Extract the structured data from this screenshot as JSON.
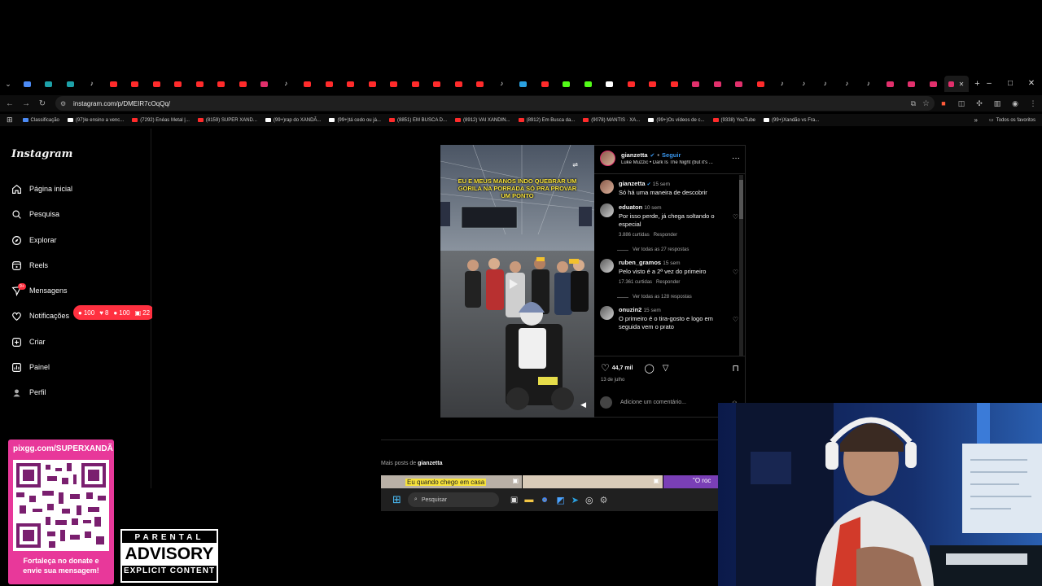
{
  "browser": {
    "tabs": [
      {
        "color": "#4c8bf5",
        "kind": "fav"
      },
      {
        "color": "#1da1a8",
        "kind": "fav"
      },
      {
        "color": "#1da1a8",
        "kind": "fav"
      },
      {
        "color": "#fff",
        "kind": "tiktok"
      },
      {
        "color": "#ff2b2b",
        "kind": "fav"
      },
      {
        "color": "#ff2b2b",
        "kind": "fav"
      },
      {
        "color": "#ff2b2b",
        "kind": "fav"
      },
      {
        "color": "#ff2b2b",
        "kind": "fav"
      },
      {
        "color": "#ff2b2b",
        "kind": "fav"
      },
      {
        "color": "#ff2b2b",
        "kind": "fav"
      },
      {
        "color": "#ff2b2b",
        "kind": "fav"
      },
      {
        "color": "#e1306c",
        "kind": "fav"
      },
      {
        "color": "#fff",
        "kind": "tiktok"
      },
      {
        "color": "#ff2b2b",
        "kind": "fav"
      },
      {
        "color": "#ff2b2b",
        "kind": "fav"
      },
      {
        "color": "#ff2b2b",
        "kind": "fav"
      },
      {
        "color": "#ff2b2b",
        "kind": "fav"
      },
      {
        "color": "#ff2b2b",
        "kind": "fav"
      },
      {
        "color": "#ff2b2b",
        "kind": "fav"
      },
      {
        "color": "#ff2b2b",
        "kind": "fav"
      },
      {
        "color": "#ff2b2b",
        "kind": "fav"
      },
      {
        "color": "#ff2b2b",
        "kind": "fav"
      },
      {
        "color": "#fff",
        "kind": "tiktok"
      },
      {
        "color": "#2aa1e0",
        "kind": "fav"
      },
      {
        "color": "#ff2b2b",
        "kind": "fav"
      },
      {
        "color": "#53fc18",
        "kind": "fav"
      },
      {
        "color": "#53fc18",
        "kind": "fav"
      },
      {
        "color": "#ffffff",
        "kind": "fav"
      },
      {
        "color": "#ff2b2b",
        "kind": "fav"
      },
      {
        "color": "#ff2b2b",
        "kind": "fav"
      },
      {
        "color": "#ff2b2b",
        "kind": "fav"
      },
      {
        "color": "#e1306c",
        "kind": "fav"
      },
      {
        "color": "#e1306c",
        "kind": "fav"
      },
      {
        "color": "#e1306c",
        "kind": "fav"
      },
      {
        "color": "#ff2b2b",
        "kind": "fav"
      },
      {
        "color": "#fff",
        "kind": "tiktok"
      },
      {
        "color": "#fff",
        "kind": "tiktok"
      },
      {
        "color": "#fff",
        "kind": "tiktok"
      },
      {
        "color": "#fff",
        "kind": "tiktok"
      },
      {
        "color": "#fff",
        "kind": "tiktok"
      },
      {
        "color": "#e1306c",
        "kind": "fav"
      },
      {
        "color": "#e1306c",
        "kind": "fav"
      },
      {
        "color": "#e1306c",
        "kind": "fav"
      }
    ],
    "url": "instagram.com/p/DMEIR7cOqQq/",
    "window_controls": [
      "–",
      "□",
      "✕"
    ],
    "bookmarks": [
      {
        "label": "Classificação",
        "color": "#4c8bf5"
      },
      {
        "label": "(97)Ie ensino a venc...",
        "color": "#ffffff"
      },
      {
        "label": "(7292) Enéas Metal |...",
        "color": "#ff2b2b"
      },
      {
        "label": "(8159) SUPER XAND...",
        "color": "#ff2b2b"
      },
      {
        "label": "(99+)rap do XANDÃ...",
        "color": "#ffffff"
      },
      {
        "label": "(99+)tá cedo ou já...",
        "color": "#ffffff"
      },
      {
        "label": "(8851) EM BUSCA D...",
        "color": "#ff2b2b"
      },
      {
        "label": "(8912) VAI XANDIN...",
        "color": "#ff2b2b"
      },
      {
        "label": "(8912) Em Busca da...",
        "color": "#ff2b2b"
      },
      {
        "label": "(9078) MANTIS · XA...",
        "color": "#ff2b2b"
      },
      {
        "label": "(99+)Os vídeos de c...",
        "color": "#ffffff"
      },
      {
        "label": "(9338) YouTube",
        "color": "#ff2b2b"
      },
      {
        "label": "(99+)Xandão vs Fra...",
        "color": "#ffffff"
      }
    ],
    "bookmarks_folder": "Todos os favoritos"
  },
  "instagram": {
    "logo": "Instagram",
    "nav": [
      {
        "label": "Página inicial",
        "icon": "home-icon"
      },
      {
        "label": "Pesquisa",
        "icon": "search-icon"
      },
      {
        "label": "Explorar",
        "icon": "compass-icon"
      },
      {
        "label": "Reels",
        "icon": "reels-icon"
      },
      {
        "label": "Mensagens",
        "icon": "messenger-icon"
      },
      {
        "label": "Notificações",
        "icon": "heart-icon"
      },
      {
        "label": "Criar",
        "icon": "plus-square-icon"
      },
      {
        "label": "Painel",
        "icon": "chart-icon"
      },
      {
        "label": "Perfil",
        "icon": "avatar-icon"
      }
    ],
    "messages_badge": "9+",
    "notification_pill": {
      "comments": "100",
      "likes": "8",
      "follows": "100",
      "mentions": "22"
    },
    "post": {
      "video_caption": "EU E MEUS MANOS INDO QUEBRAR UM GORILA NA PORRADA SÓ PRA PROVAR UM PONTO",
      "author": "gianzetta",
      "follow_label": "Seguir",
      "separator": "•",
      "audio": "Luke Muzzic • Dark Is The Night (but it's ...",
      "caption_time": "15 sem",
      "caption_text": "Só há uma maneira de descobrir",
      "comments": [
        {
          "user": "eduaton",
          "time": "10 sem",
          "text": "Por isso perde, já chega soltando o especial",
          "likes": "3.886 curtidas",
          "reply": "Responder",
          "replies": "Ver todas as 27 respostas"
        },
        {
          "user": "ruben_gramos",
          "time": "15 sem",
          "text": "Pelo visto é a 2ª vez do primeiro",
          "likes": "17.361 curtidas",
          "reply": "Responder",
          "replies": "Ver todas as 128 respostas"
        },
        {
          "user": "onuzin2",
          "time": "15 sem",
          "text": "O primeiro é o tira-gosto e logo em seguida vem o prato",
          "likes": "",
          "reply": "",
          "replies": ""
        }
      ],
      "likes_count": "44,7 mil",
      "date": "13 de julho",
      "comment_placeholder": "Adicione um comentário..."
    },
    "more_posts_prefix": "Mais posts de",
    "more_posts_user": "gianzetta",
    "more_posts_thumb_text": "Eu quando chego em casa",
    "more_posts_thumb_text2": "\"O roc"
  },
  "taskbar": {
    "search_placeholder": "Pesquisar"
  },
  "overlay": {
    "qr_url": "pixgg.com/SUPERXANDÃ",
    "qr_caption_1": "Fortaleça no donate e",
    "qr_caption_2": "envie sua mensagem!",
    "advisory_l1": "PARENTAL",
    "advisory_l2": "ADVISORY",
    "advisory_l3": "EXPLICIT CONTENT"
  }
}
